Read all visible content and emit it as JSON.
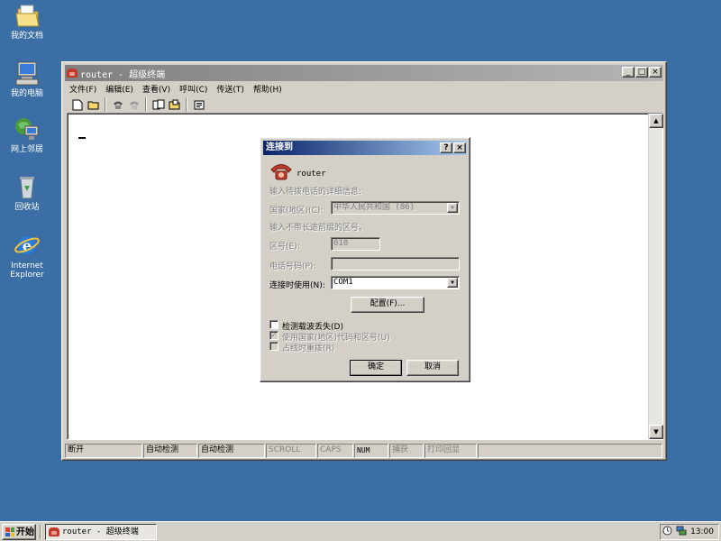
{
  "desktop": {
    "icons": [
      {
        "label": "我的文档",
        "icon": "my-documents-icon"
      },
      {
        "label": "我的电脑",
        "icon": "my-computer-icon"
      },
      {
        "label": "网上邻居",
        "icon": "network-places-icon"
      },
      {
        "label": "回收站",
        "icon": "recycle-bin-icon"
      },
      {
        "label_line1": "Internet",
        "label_line2": "Explorer",
        "icon": "internet-explorer-icon"
      }
    ]
  },
  "window": {
    "title": "router - 超级终端",
    "menu": [
      "文件(F)",
      "编辑(E)",
      "查看(V)",
      "呼叫(C)",
      "传送(T)",
      "帮助(H)"
    ],
    "toolbar": [
      "new-icon",
      "open-icon",
      "call-icon",
      "disconnect-icon",
      "send-icon",
      "receive-icon",
      "properties-icon"
    ],
    "status": [
      "断开",
      "自动检测",
      "自动检测",
      "SCROLL",
      "CAPS",
      "NUM",
      "捕获",
      "打印回显"
    ]
  },
  "dialog": {
    "title": "连接到",
    "help_btn": "?",
    "close_btn": "×",
    "connection_name": "router",
    "prompt": "输入待拨电话的详细信息:",
    "country_label": "国家(地区)(C):",
    "country_value": "中华人民共和国 (86)",
    "hint": "输入不带长途前缀的区号。",
    "area_label": "区号(E):",
    "area_value": "010",
    "phone_label": "电话号码(P):",
    "phone_value": "",
    "connect_using_label": "连接时使用(N):",
    "connect_using_value": "COM1",
    "configure_btn": "配置(F)...",
    "check_carrier": "检测载波丢失(D)",
    "use_country": "使用国家(地区)代码和区号(U)",
    "redial": "占线时重拨(R)",
    "ok": "确定",
    "cancel": "取消"
  },
  "taskbar": {
    "start": "开始",
    "task": "router - 超级终端",
    "clock": "13:00"
  }
}
